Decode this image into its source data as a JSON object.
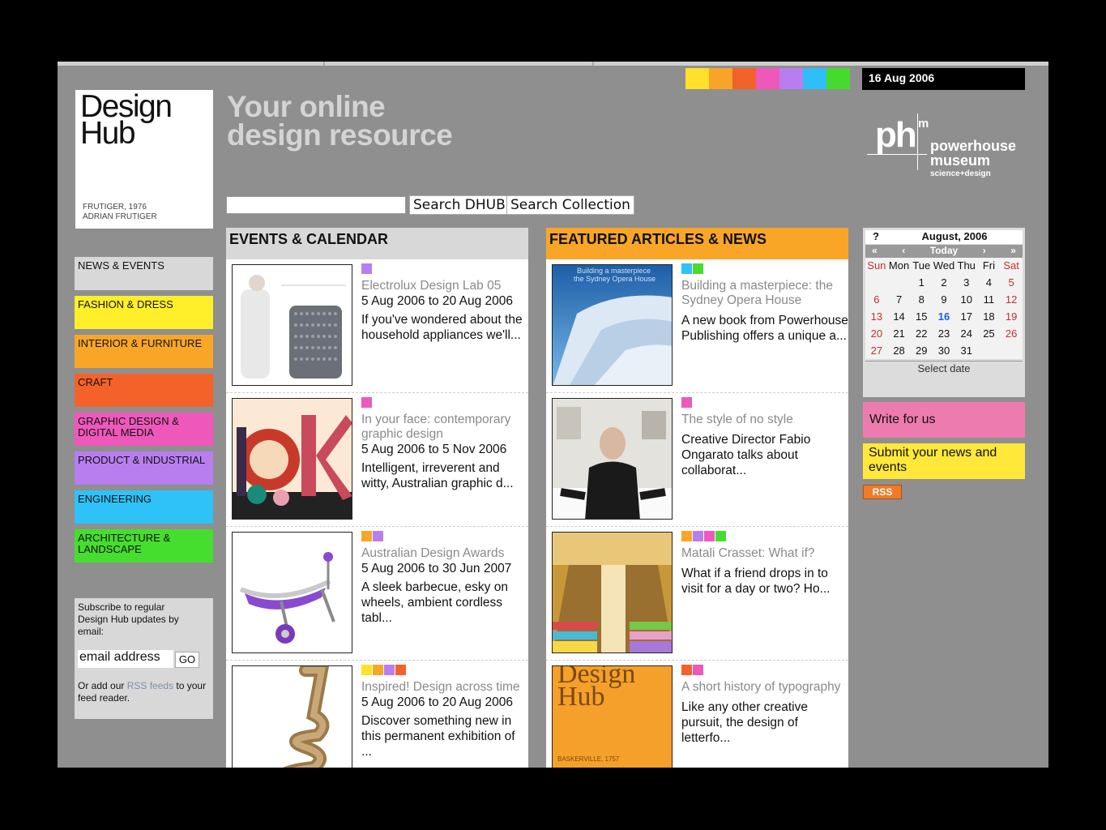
{
  "header": {
    "logo_line1": "Design",
    "logo_line2": "Hub",
    "logo_caption1": "FRUTIGER, 1976",
    "logo_caption2": "ADRIAN FRUTIGER",
    "tagline_line1": "Your online",
    "tagline_line2": "design resource",
    "date": "16 Aug 2006",
    "swatch_colors": [
      "#ffe02a",
      "#f8a428",
      "#f2622a",
      "#ee58bb",
      "#b87ef0",
      "#2ebef8",
      "#46da2e"
    ],
    "museum_ph": "ph",
    "museum_m": "m",
    "museum_name1": "powerhouse",
    "museum_name2": "museum",
    "museum_sub": "science+design"
  },
  "search": {
    "placeholder": "",
    "search_dhub_label": "Search DHUB",
    "search_collection_label": "Search Collection"
  },
  "nav": [
    {
      "label": "NEWS & EVENTS",
      "color": "#d8d8d8"
    },
    {
      "label": "FASHION & DRESS",
      "color": "#ffee2a"
    },
    {
      "label": "INTERIOR & FURNITURE",
      "color": "#f9a628"
    },
    {
      "label": "CRAFT",
      "color": "#f4622a"
    },
    {
      "label": "GRAPHIC DESIGN & DIGITAL MEDIA",
      "color": "#ee58bb"
    },
    {
      "label": "PRODUCT & INDUSTRIAL",
      "color": "#b87ef0"
    },
    {
      "label": "ENGINEERING",
      "color": "#2ec2f8"
    },
    {
      "label": "ARCHITECTURE & LANDSCAPE",
      "color": "#46de2e"
    }
  ],
  "subscribe": {
    "text": "Subscribe to regular Design Hub updates by email:",
    "email_value": "email address",
    "go_label": "GO",
    "or_text_before": "Or add our ",
    "rss_link": "RSS feeds",
    "or_text_after": " to your feed reader."
  },
  "events": {
    "heading": "EVENTS & CALENDAR",
    "heading_color": "#d8d8d8",
    "items": [
      {
        "title": "Electrolux Design Lab 05",
        "date": "5 Aug 2006 to 20 Aug 2006",
        "desc": "If you've wondered about the household appliances we'll...",
        "tags": [
          "#b87ef0"
        ]
      },
      {
        "title": "In your face: contemporary graphic design",
        "date": "5 Aug 2006 to 5 Nov 2006",
        "desc": "Intelligent, irreverent and witty, Australian graphic d...",
        "tags": [
          "#ee58bb"
        ]
      },
      {
        "title": "Australian Design Awards",
        "date": "5 Aug 2006 to 30 Jun 2007",
        "desc": "A sleek barbecue, esky on wheels, ambient cordless tabl...",
        "tags": [
          "#f9a628",
          "#b87ef0"
        ]
      },
      {
        "title": "Inspired! Design across time",
        "date": "5 Aug 2006 to 20 Aug 2006",
        "desc": "Discover something new in this permanent exhibition of ...",
        "tags": [
          "#ffe02a",
          "#f9a628",
          "#b87ef0",
          "#f4622a"
        ]
      }
    ]
  },
  "featured": {
    "heading": "FEATURED ARTICLES & NEWS",
    "heading_color": "#f9a628",
    "items": [
      {
        "title": "Building a masterpiece: the Sydney Opera House",
        "desc": "A new book from Powerhouse Publishing offers a unique a...",
        "tags": [
          "#2ec2f8",
          "#46de2e"
        ],
        "thumb_text": "Building a masterpiece the Sydney Opera House"
      },
      {
        "title": "The style of no style",
        "desc": "Creative Director Fabio Ongarato talks about collaborat...",
        "tags": [
          "#ee58bb"
        ]
      },
      {
        "title": "Matali Crasset: What if?",
        "desc": "What if a friend drops in to visit for a day or two? Ho...",
        "tags": [
          "#f9a628",
          "#b87ef0",
          "#ee58bb",
          "#46de2e"
        ]
      },
      {
        "title": "A short history of typography",
        "desc": "Like any other creative pursuit, the design of letterfo...",
        "tags": [
          "#f4622a",
          "#ee58bb"
        ],
        "thumb_text1": "Design",
        "thumb_text2": "Hub",
        "thumb_caption": "BASKERVILLE, 1757"
      }
    ]
  },
  "calendar": {
    "help": "?",
    "month": "August, 2006",
    "nav": [
      "«",
      "‹",
      "Today",
      "›",
      "»"
    ],
    "days": [
      "Sun",
      "Mon",
      "Tue",
      "Wed",
      "Thu",
      "Fri",
      "Sat"
    ],
    "weeks": [
      [
        "",
        "",
        "1",
        "2",
        "3",
        "4",
        "5"
      ],
      [
        "6",
        "7",
        "8",
        "9",
        "10",
        "11",
        "12"
      ],
      [
        "13",
        "14",
        "15",
        "16",
        "17",
        "18",
        "19"
      ],
      [
        "20",
        "21",
        "22",
        "23",
        "24",
        "25",
        "26"
      ],
      [
        "27",
        "28",
        "29",
        "30",
        "31",
        "",
        ""
      ]
    ],
    "today": "16",
    "select_label": "Select date"
  },
  "sidebar": {
    "write_label": "Write for us",
    "submit_label": "Submit your news and events",
    "rss_label": "RSS"
  }
}
